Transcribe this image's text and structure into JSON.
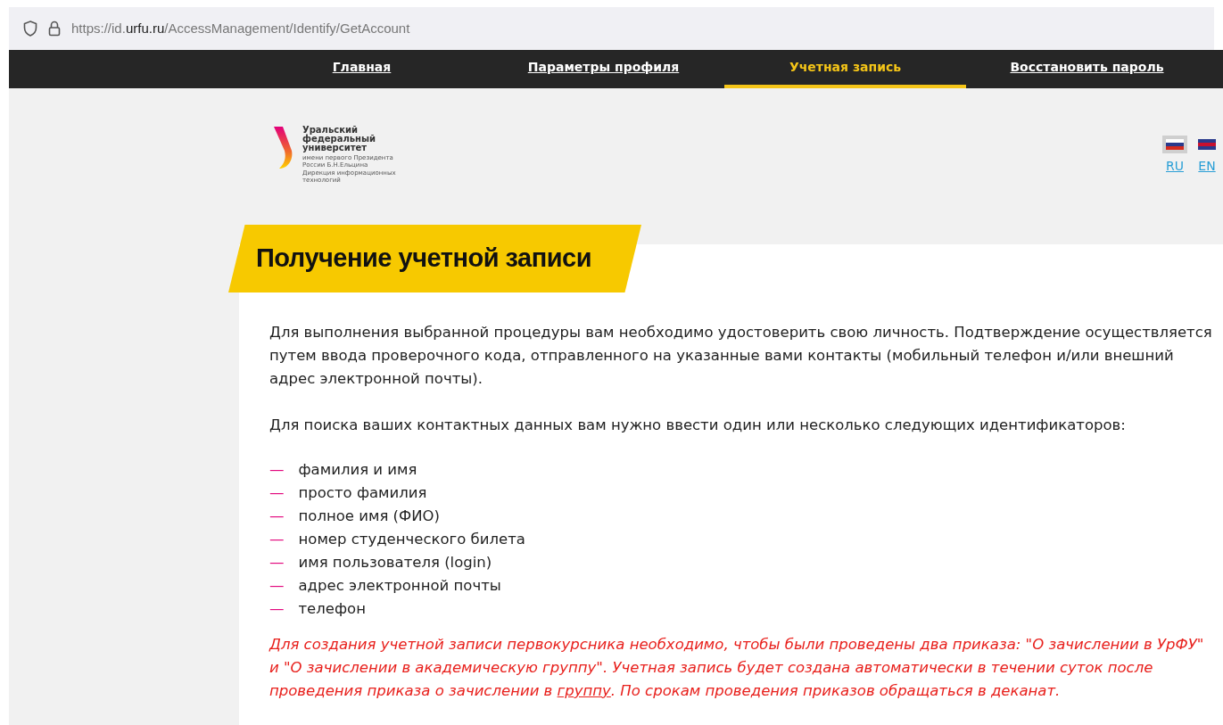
{
  "address_bar": {
    "url_prefix": "https://id.",
    "url_domain": "urfu.ru",
    "url_path": "/AccessManagement/Identify/GetAccount"
  },
  "nav": [
    {
      "label": "Главная",
      "selected": false
    },
    {
      "label": "Параметры профиля",
      "selected": false
    },
    {
      "label": "Учетная запись",
      "selected": true
    },
    {
      "label": "Восстановить пароль",
      "selected": false
    }
  ],
  "logo": {
    "lines": [
      "Уральский",
      "федеральный",
      "университет"
    ],
    "subtitle": "имени первого Президента России Б.Н.Ельцина",
    "department": "Дирекция информационных технологий"
  },
  "languages": [
    {
      "code": "RU",
      "selected": true
    },
    {
      "code": "EN",
      "selected": false
    }
  ],
  "title": "Получение учетной записи",
  "intro": "Для выполнения выбранной процедуры вам необходимо удостоверить свою личность. Подтверждение осуществляется путем ввода проверочного кода, отправленного на указанные вами контакты (мобильный телефон и/или внешний адрес электронной почты).",
  "identifiers_intro": "Для поиска ваших контактных данных вам нужно ввести один или несколько следующих идентификаторов:",
  "identifiers": [
    {
      "marker": "—",
      "text": "фамилия и имя"
    },
    {
      "marker": "—",
      "text": "просто фамилия"
    },
    {
      "marker": "—",
      "text": "полное имя (ФИО)"
    },
    {
      "marker": "—",
      "text": "номер студенческого билета"
    },
    {
      "marker": "—",
      "text": "имя пользователя (login)"
    },
    {
      "marker": "—",
      "text": "адрес электронной почты"
    },
    {
      "marker": "—",
      "text": "телефон"
    }
  ],
  "notice": {
    "before": "Для создания учетной записи первокурсника необходимо, чтобы были проведены два приказа: \"О зачислении в УрФУ\" и \"О зачислении в академическую группу\". Учетная запись будет создана автоматически в течении суток после проведения приказа о зачислении в",
    "link": "группу",
    "after": ". По срокам проведения приказов обращаться в деканат."
  }
}
